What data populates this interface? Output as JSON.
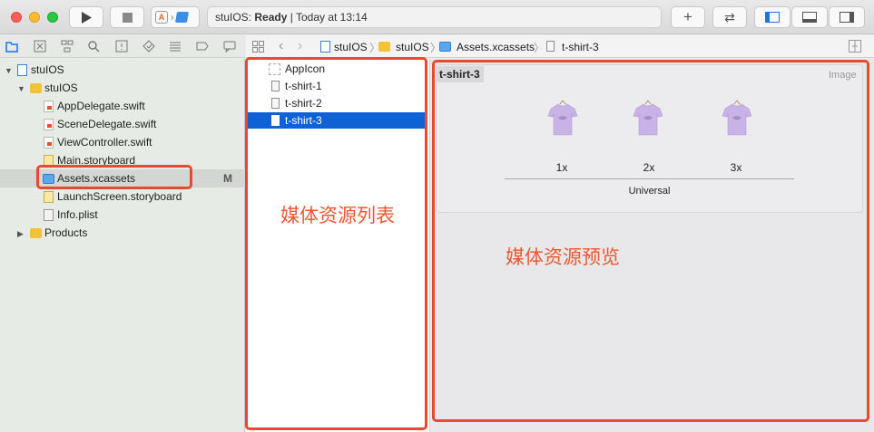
{
  "toolbar": {
    "scheme": "A",
    "status_app": "stuIOS: ",
    "status_state": "Ready",
    "status_time": "| Today at 13:14",
    "plus": "+",
    "swap": "⇄"
  },
  "navigator": {
    "items": [
      {
        "label": "stuIOS"
      },
      {
        "label": "stuIOS"
      },
      {
        "label": "AppDelegate.swift"
      },
      {
        "label": "SceneDelegate.swift"
      },
      {
        "label": "ViewController.swift"
      },
      {
        "label": "Main.storyboard"
      },
      {
        "label": "Assets.xcassets",
        "badge": "M"
      },
      {
        "label": "LaunchScreen.storyboard"
      },
      {
        "label": "Info.plist"
      },
      {
        "label": "Products"
      }
    ]
  },
  "jumpbar": {
    "crumbs": [
      "stuIOS",
      "stuIOS",
      "Assets.xcassets",
      "t-shirt-3"
    ]
  },
  "assets": {
    "items": [
      "AppIcon",
      "t-shirt-1",
      "t-shirt-2",
      "t-shirt-3"
    ],
    "selected": "t-shirt-3"
  },
  "preview": {
    "title": "t-shirt-3",
    "kind": "Image",
    "slots": [
      "1x",
      "2x",
      "3x"
    ],
    "group": "Universal"
  },
  "annotations": {
    "list": "媒体资源列表",
    "preview": "媒体资源预览"
  },
  "colors": {
    "accent": "#0f61d6",
    "annotation": "#e84a2c",
    "shirt": "#c9b2e6"
  }
}
